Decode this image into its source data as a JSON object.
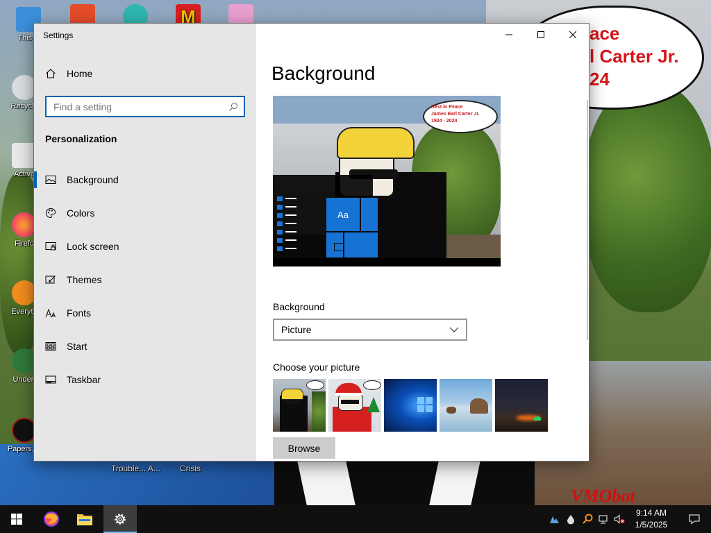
{
  "desktop": {
    "icons": [
      {
        "label": "This P",
        "color": "#3b8fd9"
      },
      {
        "label": "Recycle",
        "color": "#4da35a"
      },
      {
        "label": "Activa",
        "color": "#e8e8e8"
      },
      {
        "label": "Firefo",
        "color": "#ff7a1a"
      },
      {
        "label": "Everyth",
        "color": "#f28c1e"
      },
      {
        "label": "Undert",
        "color": "#2f7a3a"
      },
      {
        "label": "Papers, P",
        "color": "#a01818"
      }
    ],
    "top_icons": [
      {
        "name": "app-icon-1",
        "color": "#e44c2a"
      },
      {
        "name": "app-icon-2",
        "color": "#2fb6b0"
      },
      {
        "name": "mcdonalds-icon",
        "color": "#d62020"
      },
      {
        "name": "app-icon-4",
        "color": "#e9a0d0"
      }
    ],
    "bottom_labels": [
      "Trouble... A...",
      "Crisis"
    ],
    "bubble_text": "ace\nl Carter Jr.\n24",
    "signature": "VMObot"
  },
  "window": {
    "title": "Settings",
    "caption": {
      "minimize": "—",
      "maximize": "☐",
      "close": "✕"
    }
  },
  "sidebar": {
    "home_label": "Home",
    "search_placeholder": "Find a setting",
    "section_title": "Personalization",
    "items": [
      {
        "label": "Background",
        "icon": "picture-icon",
        "active": true
      },
      {
        "label": "Colors",
        "icon": "palette-icon",
        "active": false
      },
      {
        "label": "Lock screen",
        "icon": "lock-screen-icon",
        "active": false
      },
      {
        "label": "Themes",
        "icon": "themes-icon",
        "active": false
      },
      {
        "label": "Fonts",
        "icon": "fonts-icon",
        "active": false
      },
      {
        "label": "Start",
        "icon": "start-icon",
        "active": false
      },
      {
        "label": "Taskbar",
        "icon": "taskbar-icon",
        "active": false
      }
    ]
  },
  "main": {
    "title": "Background",
    "preview": {
      "bubble_text": "Rest in Peace\nJames Earl Carter Jr.\n1924 - 2024",
      "tile_text": "Aa"
    },
    "background_label": "Background",
    "background_value": "Picture",
    "choose_label": "Choose your picture",
    "thumbnails": [
      {
        "name": "thumb-carter"
      },
      {
        "name": "thumb-santa"
      },
      {
        "name": "thumb-windows"
      },
      {
        "name": "thumb-beach"
      },
      {
        "name": "thumb-night-sky"
      }
    ],
    "browse_label": "Browse"
  },
  "taskbar": {
    "apps": [
      {
        "name": "start-button",
        "active": false
      },
      {
        "name": "firefox-button",
        "active": false
      },
      {
        "name": "file-explorer-button",
        "active": false
      },
      {
        "name": "settings-button",
        "active": true
      }
    ],
    "clock_time": "9:14 AM",
    "clock_date": "1/5/2025"
  },
  "colors": {
    "accent": "#0063b1",
    "sidebar_bg": "#e6e6e6",
    "taskbar_bg": "#101010",
    "tile_blue": "#1673d4"
  }
}
